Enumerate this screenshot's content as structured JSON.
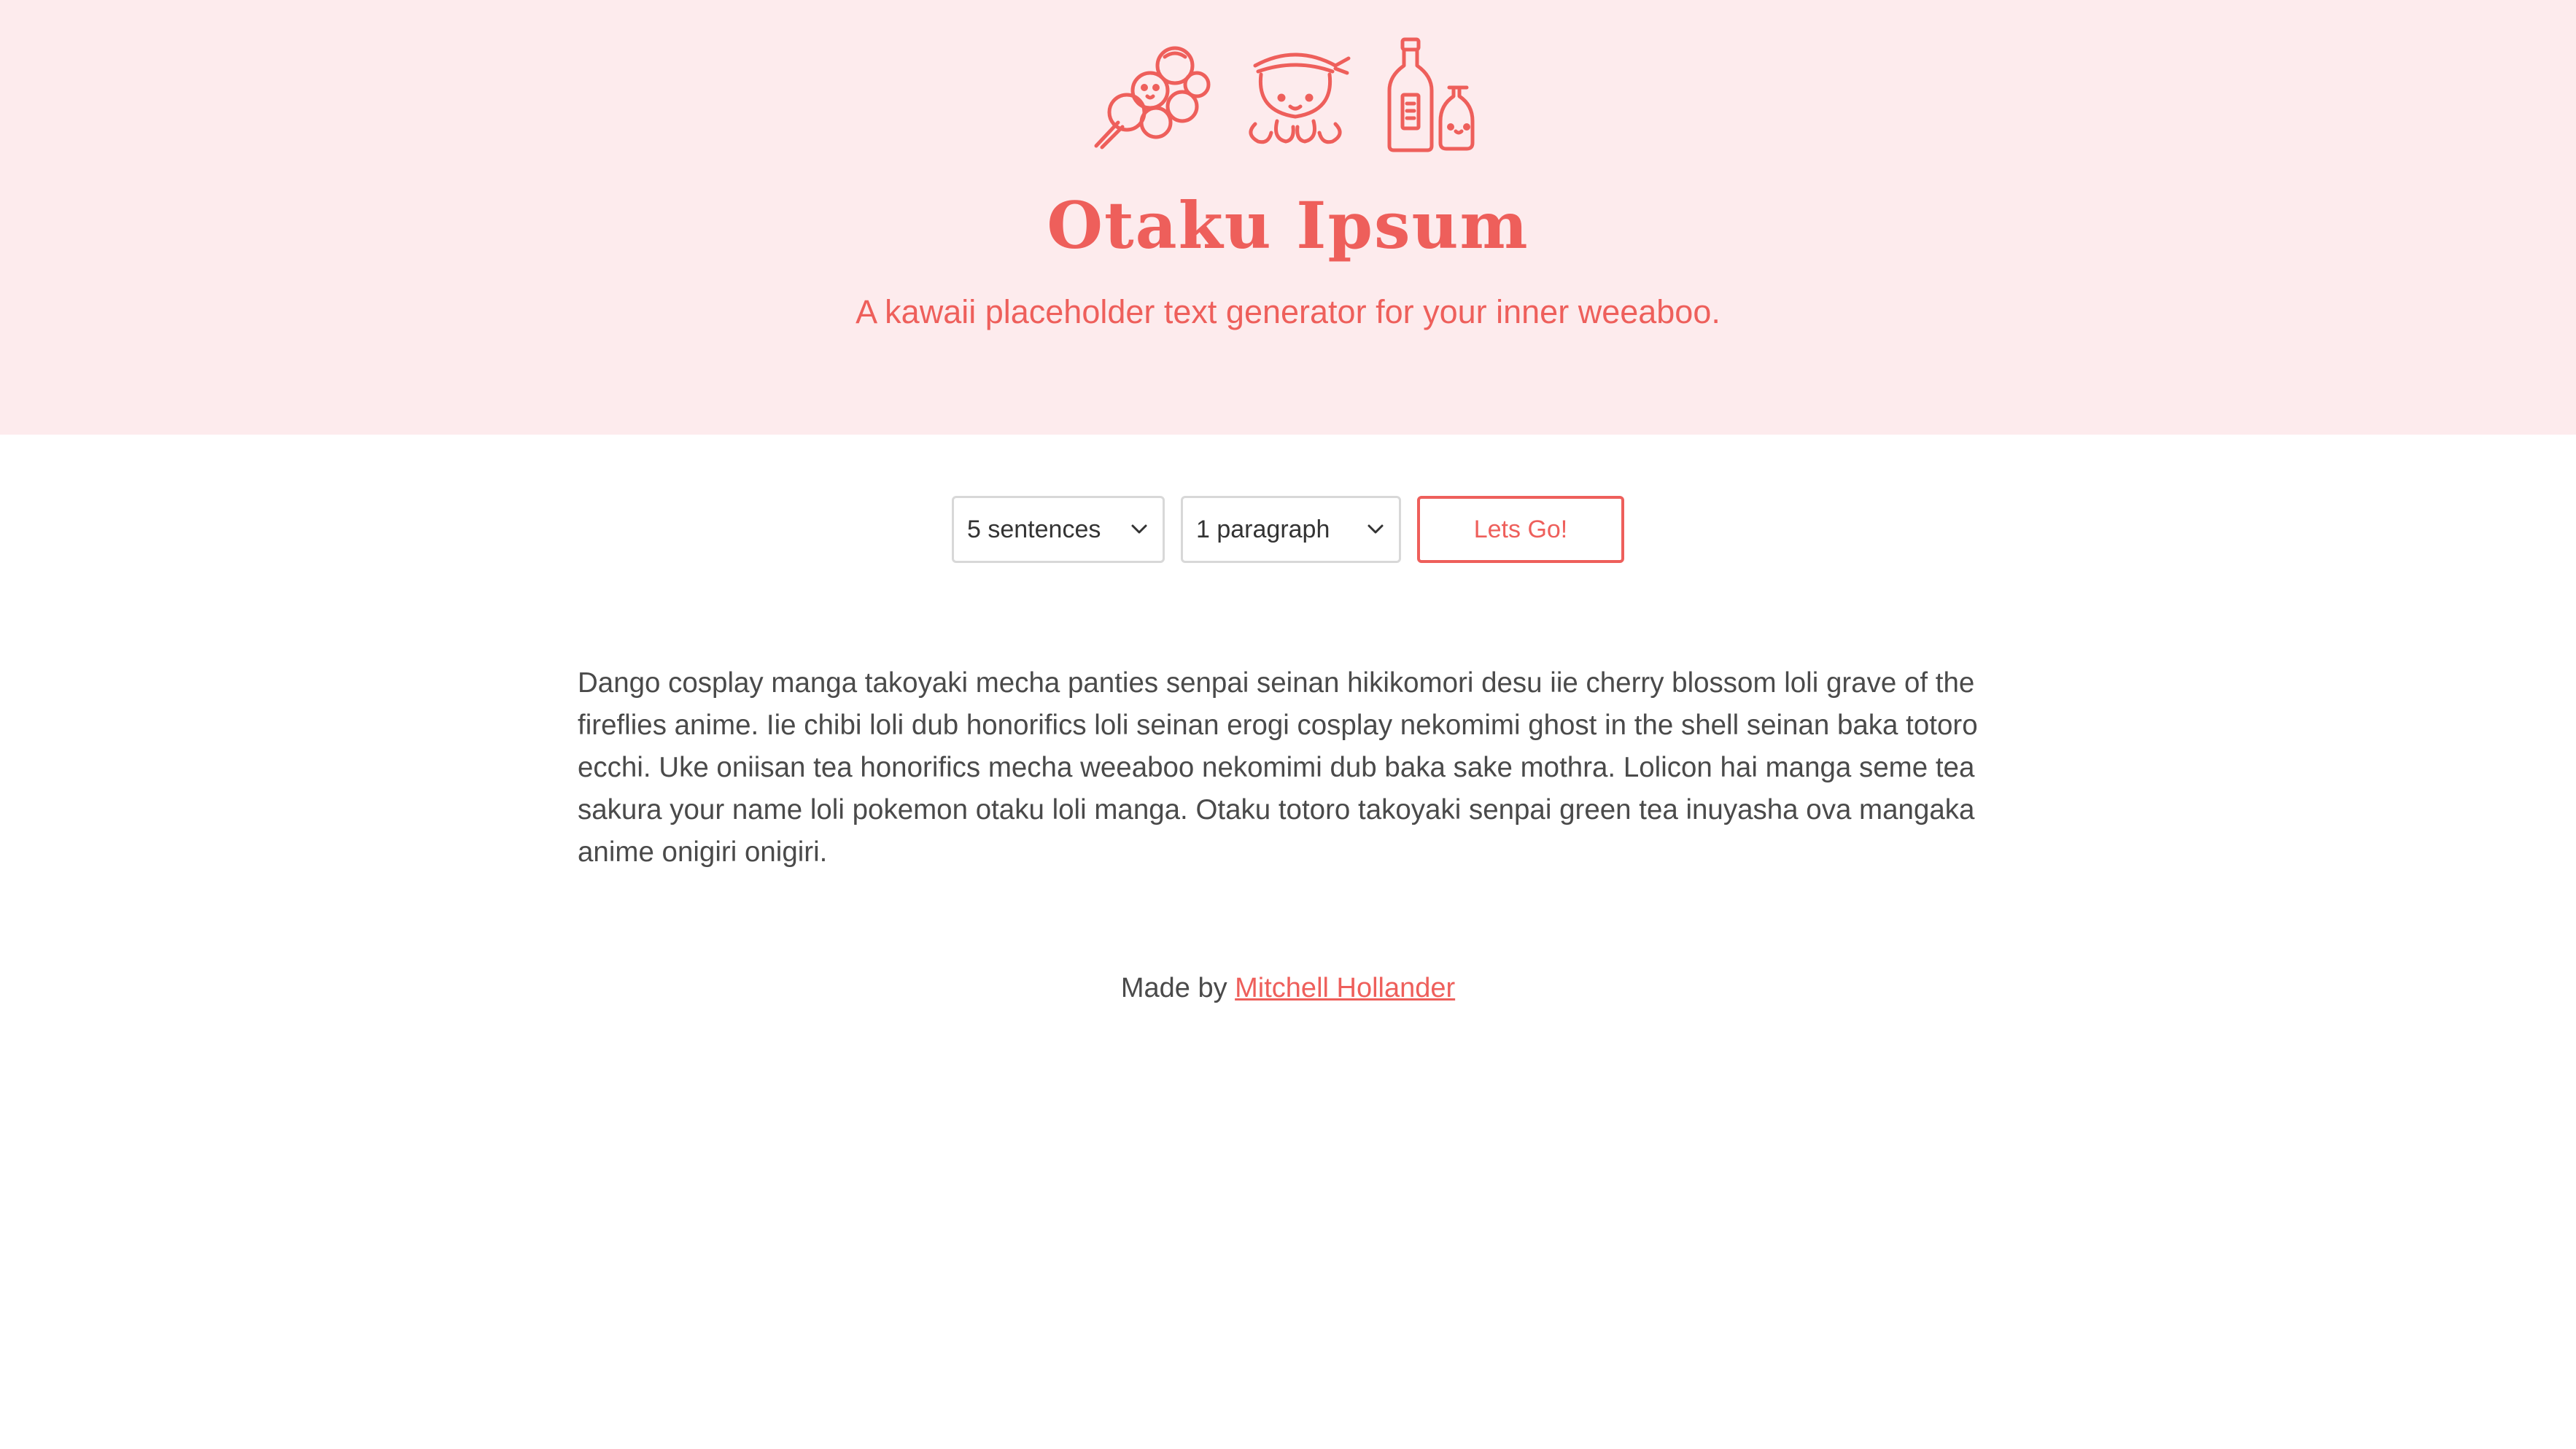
{
  "header": {
    "icons": [
      "dango-icon",
      "takoyaki-octopus-icon",
      "sake-bottle-icon"
    ],
    "title": "Otaku Ipsum",
    "subtitle": "A kawaii placeholder text generator for your inner weeaboo."
  },
  "controls": {
    "sentences_select": {
      "value": "5 sentences"
    },
    "paragraphs_select": {
      "value": "1 paragraph"
    },
    "submit_label": "Lets Go!"
  },
  "output": {
    "text": "Dango cosplay manga takoyaki mecha panties senpai seinan hikikomori desu iie cherry blossom loli grave of the fireflies anime. Iie chibi loli dub honorifics loli seinan erogi cosplay nekomimi ghost in the shell seinan baka totoro ecchi. Uke oniisan tea honorifics mecha weeaboo nekomimi dub baka sake mothra. Lolicon hai manga seme tea sakura your name loli pokemon otaku loli manga. Otaku totoro takoyaki senpai green tea inuyasha ova mangaka anime onigiri onigiri."
  },
  "footer": {
    "prefix": "Made by",
    "author_link": "Mitchell Hollander"
  },
  "colors": {
    "accent": "#ee5f5b",
    "hero_background": "#fdebed",
    "body_text": "#4a4a4a"
  }
}
